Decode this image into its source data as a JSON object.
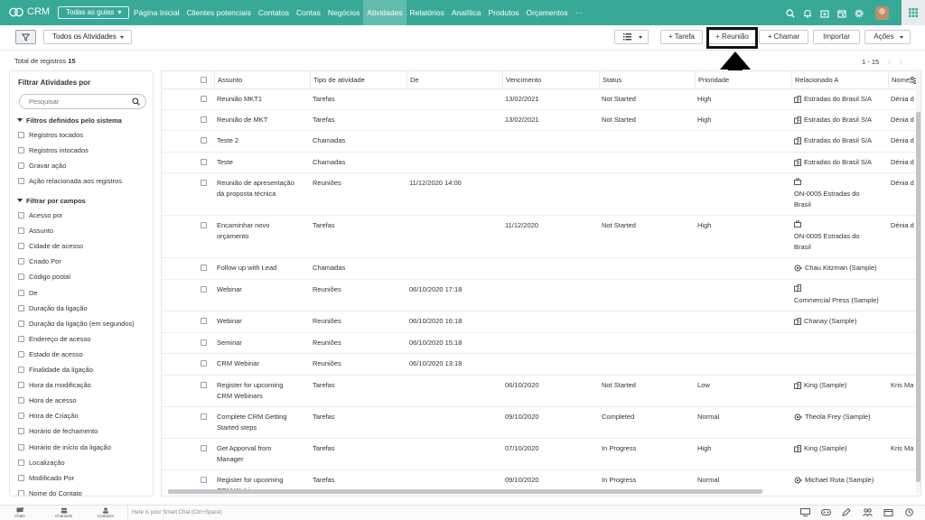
{
  "topbar": {
    "brand": "CRM",
    "guides_label": "Todas as guias",
    "tabs": [
      {
        "label": "Página Inicial"
      },
      {
        "label": "Clientes potenciais"
      },
      {
        "label": "Contatos"
      },
      {
        "label": "Contas"
      },
      {
        "label": "Negócios"
      },
      {
        "label": "Atividades",
        "active": true
      },
      {
        "label": "Relatórios"
      },
      {
        "label": "Analítica"
      },
      {
        "label": "Produtos"
      },
      {
        "label": "Orçamentos"
      },
      {
        "label": "···"
      }
    ],
    "icons": [
      "search-icon",
      "bell-icon",
      "calendar-add-icon",
      "calendar-icon",
      "gear-icon"
    ]
  },
  "toolbar": {
    "view_select": "Todos os Atividades",
    "buttons": {
      "tarefa": "+ Tarefa",
      "reuniao": "+ Reunião",
      "chamar": "+ Chamar",
      "importar": "Importar",
      "acoes": "Ações"
    }
  },
  "records": {
    "label": "Total de registros",
    "count": "15"
  },
  "pager": {
    "range": "1 - 15",
    "prev": "‹",
    "next": "›"
  },
  "filter": {
    "title": "Filtrar Atividades por",
    "search_placeholder": "Pesquisar",
    "system_section": "Filtros definidos pelo sistema",
    "system_items": [
      "Registros tocados",
      "Registros intocados",
      "Gravar ação",
      "Ação relacionada aos registros"
    ],
    "fields_section": "Filtrar por campos",
    "field_items": [
      "Acesso por",
      "Assunto",
      "Cidade de acesso",
      "Criado Por",
      "Código postal",
      "De",
      "Duração da ligação",
      "Duração da ligação (em segundos)",
      "Endereço de acesso",
      "Estado de acesso",
      "Finalidade da ligação",
      "Hora da modificação",
      "Hora de acesso",
      "Hora de Criação",
      "Horário de fechamento",
      "Horário de início da ligação",
      "Localização",
      "Modificado Por",
      "Nome do Contato"
    ]
  },
  "table": {
    "columns": [
      "Assunto",
      "Tipo de atividade",
      "De",
      "Vencimento",
      "Status",
      "Prioridade",
      "Relacionado A",
      "Nome"
    ],
    "rows": [
      {
        "assunto": "Reunião MKT1",
        "tipo": "Tarefas",
        "de": "",
        "venc": "13/02/2021",
        "status": "Not Started",
        "prio": "High",
        "rel": "Estradas do Brasil S/A",
        "rel_icon": "building",
        "nome": "Dénia d"
      },
      {
        "assunto": "Reunião de MKT",
        "tipo": "Tarefas",
        "de": "",
        "venc": "13/02/2021",
        "status": "Not Started",
        "prio": "High",
        "rel": "Estradas do Brasil S/A",
        "rel_icon": "building",
        "nome": "Dénia d"
      },
      {
        "assunto": "Teste 2",
        "tipo": "Chamadas",
        "de": "",
        "venc": "",
        "status": "",
        "prio": "",
        "rel": "Estradas do Brasil S/A",
        "rel_icon": "building",
        "nome": "Dénia d"
      },
      {
        "assunto": "Teste",
        "tipo": "Chamadas",
        "de": "",
        "venc": "",
        "status": "",
        "prio": "",
        "rel": "Estradas do Brasil S/A",
        "rel_icon": "building",
        "nome": "Dénia d"
      },
      {
        "assunto": "Reunião de apresentação\nda proposta técnica",
        "tipo": "Reuniões",
        "de": "11/12/2020 14:00",
        "venc": "",
        "status": "",
        "prio": "",
        "rel": "ON-0005 Estradas do\nBrasil",
        "rel_icon": "briefcase",
        "nome": "Dénia d"
      },
      {
        "assunto": "Encaminhar novo\norçamento",
        "tipo": "Tarefas",
        "de": "",
        "venc": "11/12/2020",
        "status": "Not Started",
        "prio": "High",
        "rel": "ON-0005 Estradas do\nBrasil",
        "rel_icon": "briefcase",
        "nome": "Dénia d"
      },
      {
        "assunto": "Follow up with Lead",
        "tipo": "Chamadas",
        "de": "",
        "venc": "",
        "status": "",
        "prio": "",
        "rel": "Chau Kitzman (Sample)",
        "rel_icon": "lead",
        "nome": ""
      },
      {
        "assunto": "Webinar",
        "tipo": "Reuniões",
        "de": "06/10/2020 17:18",
        "venc": "",
        "status": "",
        "prio": "",
        "rel": "Commercial Press (Sample)",
        "rel_icon": "building-top",
        "nome": ""
      },
      {
        "assunto": "Webinar",
        "tipo": "Reuniões",
        "de": "06/10/2020 16:18",
        "venc": "",
        "status": "",
        "prio": "",
        "rel": "Chanay (Sample)",
        "rel_icon": "building",
        "nome": ""
      },
      {
        "assunto": "Seminar",
        "tipo": "Reuniões",
        "de": "06/10/2020 15:18",
        "venc": "",
        "status": "",
        "prio": "",
        "rel": "",
        "rel_icon": "",
        "nome": ""
      },
      {
        "assunto": "CRM Webinar",
        "tipo": "Reuniões",
        "de": "06/10/2020 13:18",
        "venc": "",
        "status": "",
        "prio": "",
        "rel": "",
        "rel_icon": "",
        "nome": ""
      },
      {
        "assunto": "Register for upcoming\nCRM Webinars",
        "tipo": "Tarefas",
        "de": "",
        "venc": "06/10/2020",
        "status": "Not Started",
        "prio": "Low",
        "rel": "King (Sample)",
        "rel_icon": "building",
        "nome": "Kris Ma"
      },
      {
        "assunto": "Complete CRM Getting\nStarted steps",
        "tipo": "Tarefas",
        "de": "",
        "venc": "09/10/2020",
        "status": "Completed",
        "prio": "Normal",
        "rel": "Theola Frey (Sample)",
        "rel_icon": "lead",
        "nome": ""
      },
      {
        "assunto": "Get Apporval from\nManager",
        "tipo": "Tarefas",
        "de": "",
        "venc": "07/10/2020",
        "status": "In Progress",
        "prio": "High",
        "rel": "King (Sample)",
        "rel_icon": "building",
        "nome": "Kris Ma"
      },
      {
        "assunto": "Register for upcoming\nCRM Webinars",
        "tipo": "Tarefas",
        "de": "",
        "venc": "09/10/2020",
        "status": "In Progress",
        "prio": "Normal",
        "rel": "Michael Ruta (Sample)",
        "rel_icon": "lead",
        "nome": ""
      }
    ]
  },
  "bottombar": {
    "items": [
      "Chats",
      "Channels",
      "Contacts"
    ],
    "chat_placeholder": "Here is your Smart Chat (Ctrl+Space)"
  },
  "colors": {
    "brand": "#38a997",
    "highlight": "#111111"
  }
}
